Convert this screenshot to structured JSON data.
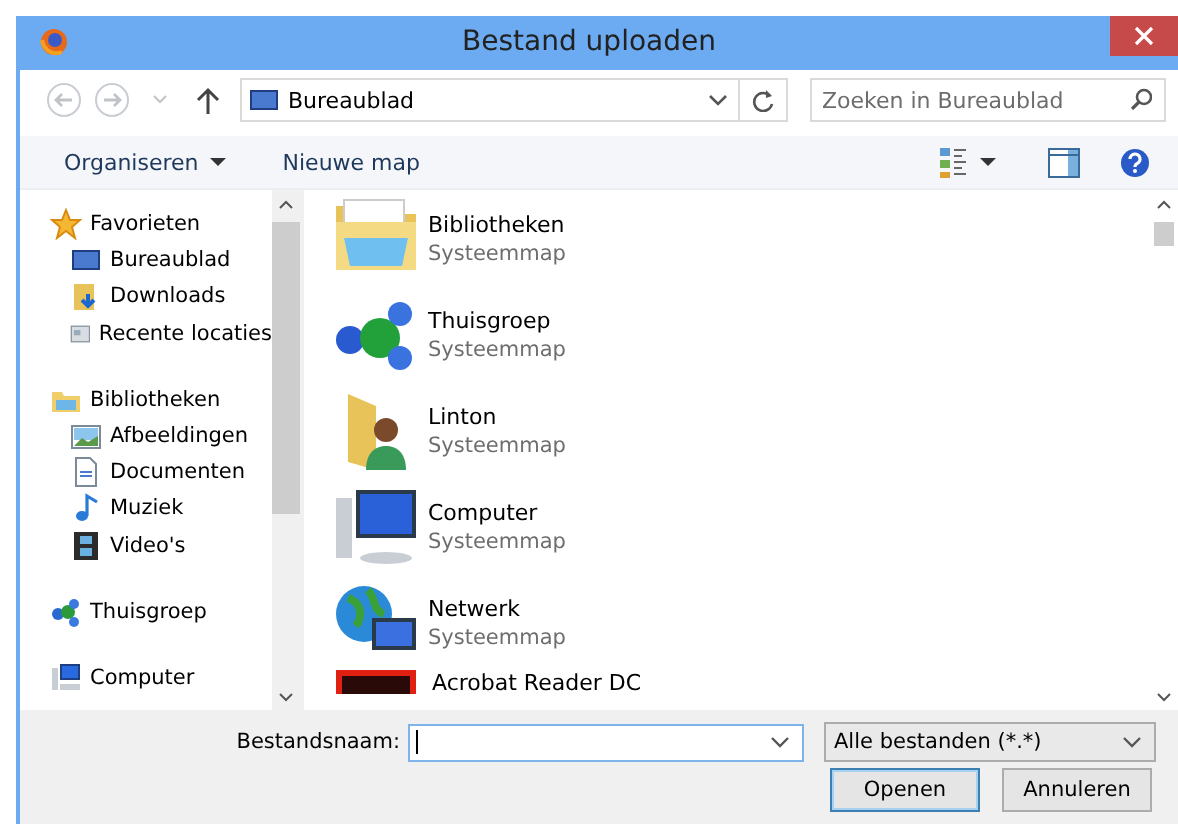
{
  "window": {
    "title": "Bestand uploaden"
  },
  "address": {
    "location": "Bureaublad"
  },
  "search": {
    "placeholder": "Zoeken in Bureaublad"
  },
  "toolbar": [
    {
      "label": "Organiseren",
      "kind": "menu"
    },
    {
      "label": "Nieuwe map",
      "kind": "button"
    }
  ],
  "navigation": [
    {
      "label": "Favorieten",
      "kind": "star",
      "children": [
        {
          "label": "Bureaublad",
          "kind": "desktop"
        },
        {
          "label": "Downloads",
          "kind": "download"
        },
        {
          "label": "Recente locaties",
          "kind": "recent"
        }
      ]
    },
    {
      "label": "Bibliotheken",
      "kind": "library",
      "children": [
        {
          "label": "Afbeeldingen",
          "kind": "pictures"
        },
        {
          "label": "Documenten",
          "kind": "document"
        },
        {
          "label": "Muziek",
          "kind": "music"
        },
        {
          "label": "Video's",
          "kind": "video"
        }
      ]
    },
    {
      "label": "Thuisgroep",
      "kind": "homegroup"
    },
    {
      "label": "Computer",
      "kind": "computer"
    }
  ],
  "files": [
    {
      "name": "Bibliotheken",
      "type": "Systeemmap",
      "kind": "library"
    },
    {
      "name": "Thuisgroep",
      "type": "Systeemmap",
      "kind": "homegroup"
    },
    {
      "name": "Linton",
      "type": "Systeemmap",
      "kind": "user"
    },
    {
      "name": "Computer",
      "type": "Systeemmap",
      "kind": "computer"
    },
    {
      "name": "Netwerk",
      "type": "Systeemmap",
      "kind": "network"
    },
    {
      "name": "Acrobat Reader DC",
      "kind": "app"
    }
  ],
  "filename": {
    "label": "Bestandsnaam:",
    "focused": true
  },
  "filter": {
    "value": "Alle bestanden (*.*)"
  },
  "buttons": [
    {
      "label": "Openen",
      "default": true
    },
    {
      "label": "Annuleren",
      "default": false
    }
  ]
}
